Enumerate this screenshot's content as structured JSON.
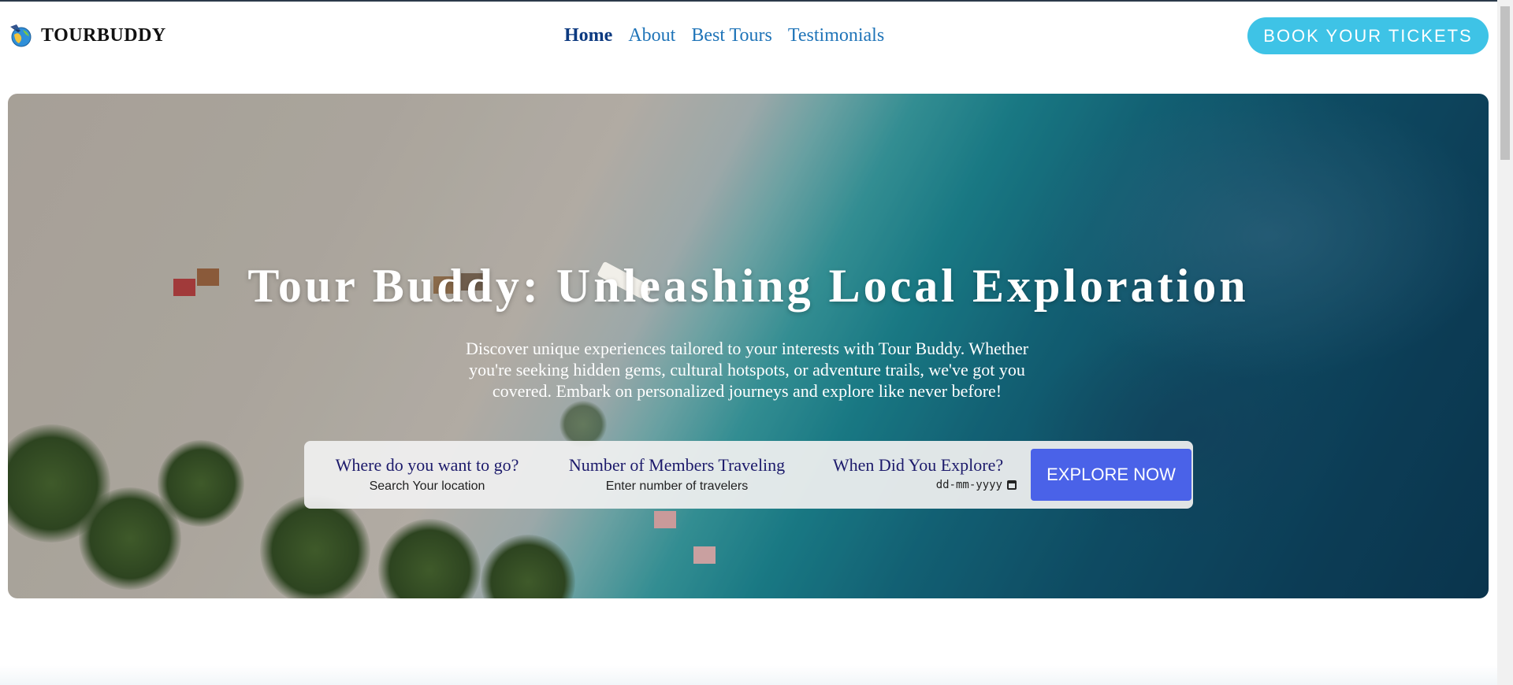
{
  "brand": {
    "name": "TOURBUDDY",
    "logo_icon": "globe-airplane-icon"
  },
  "nav": {
    "items": [
      {
        "label": "Home",
        "active": true
      },
      {
        "label": "About",
        "active": false
      },
      {
        "label": "Best Tours",
        "active": false
      },
      {
        "label": "Testimonials",
        "active": false
      }
    ]
  },
  "header": {
    "cta_label": "BOOK YOUR TICKETS"
  },
  "hero": {
    "title": "Tour Buddy: Unleashing Local Exploration",
    "description": "Discover unique experiences tailored to your interests with Tour Buddy. Whether you're seeking hidden gems, cultural hotspots, or adventure trails, we've got you covered. Embark on personalized journeys and explore like never before!"
  },
  "search": {
    "location": {
      "label": "Where do you want to go?",
      "placeholder": "Search Your location",
      "value": ""
    },
    "members": {
      "label": "Number of Members Traveling",
      "placeholder": "Enter number of travelers",
      "value": ""
    },
    "date": {
      "label": "When Did You Explore?",
      "placeholder": "dd-mm-yyyy",
      "icon": "calendar-icon"
    },
    "button_label": "EXPLORE NOW"
  },
  "colors": {
    "cta": "#3ec3e6",
    "explore_button": "#4a62e8",
    "nav_link": "#1f74b8",
    "nav_active": "#0d3a80",
    "search_label": "#1c1a6b"
  }
}
